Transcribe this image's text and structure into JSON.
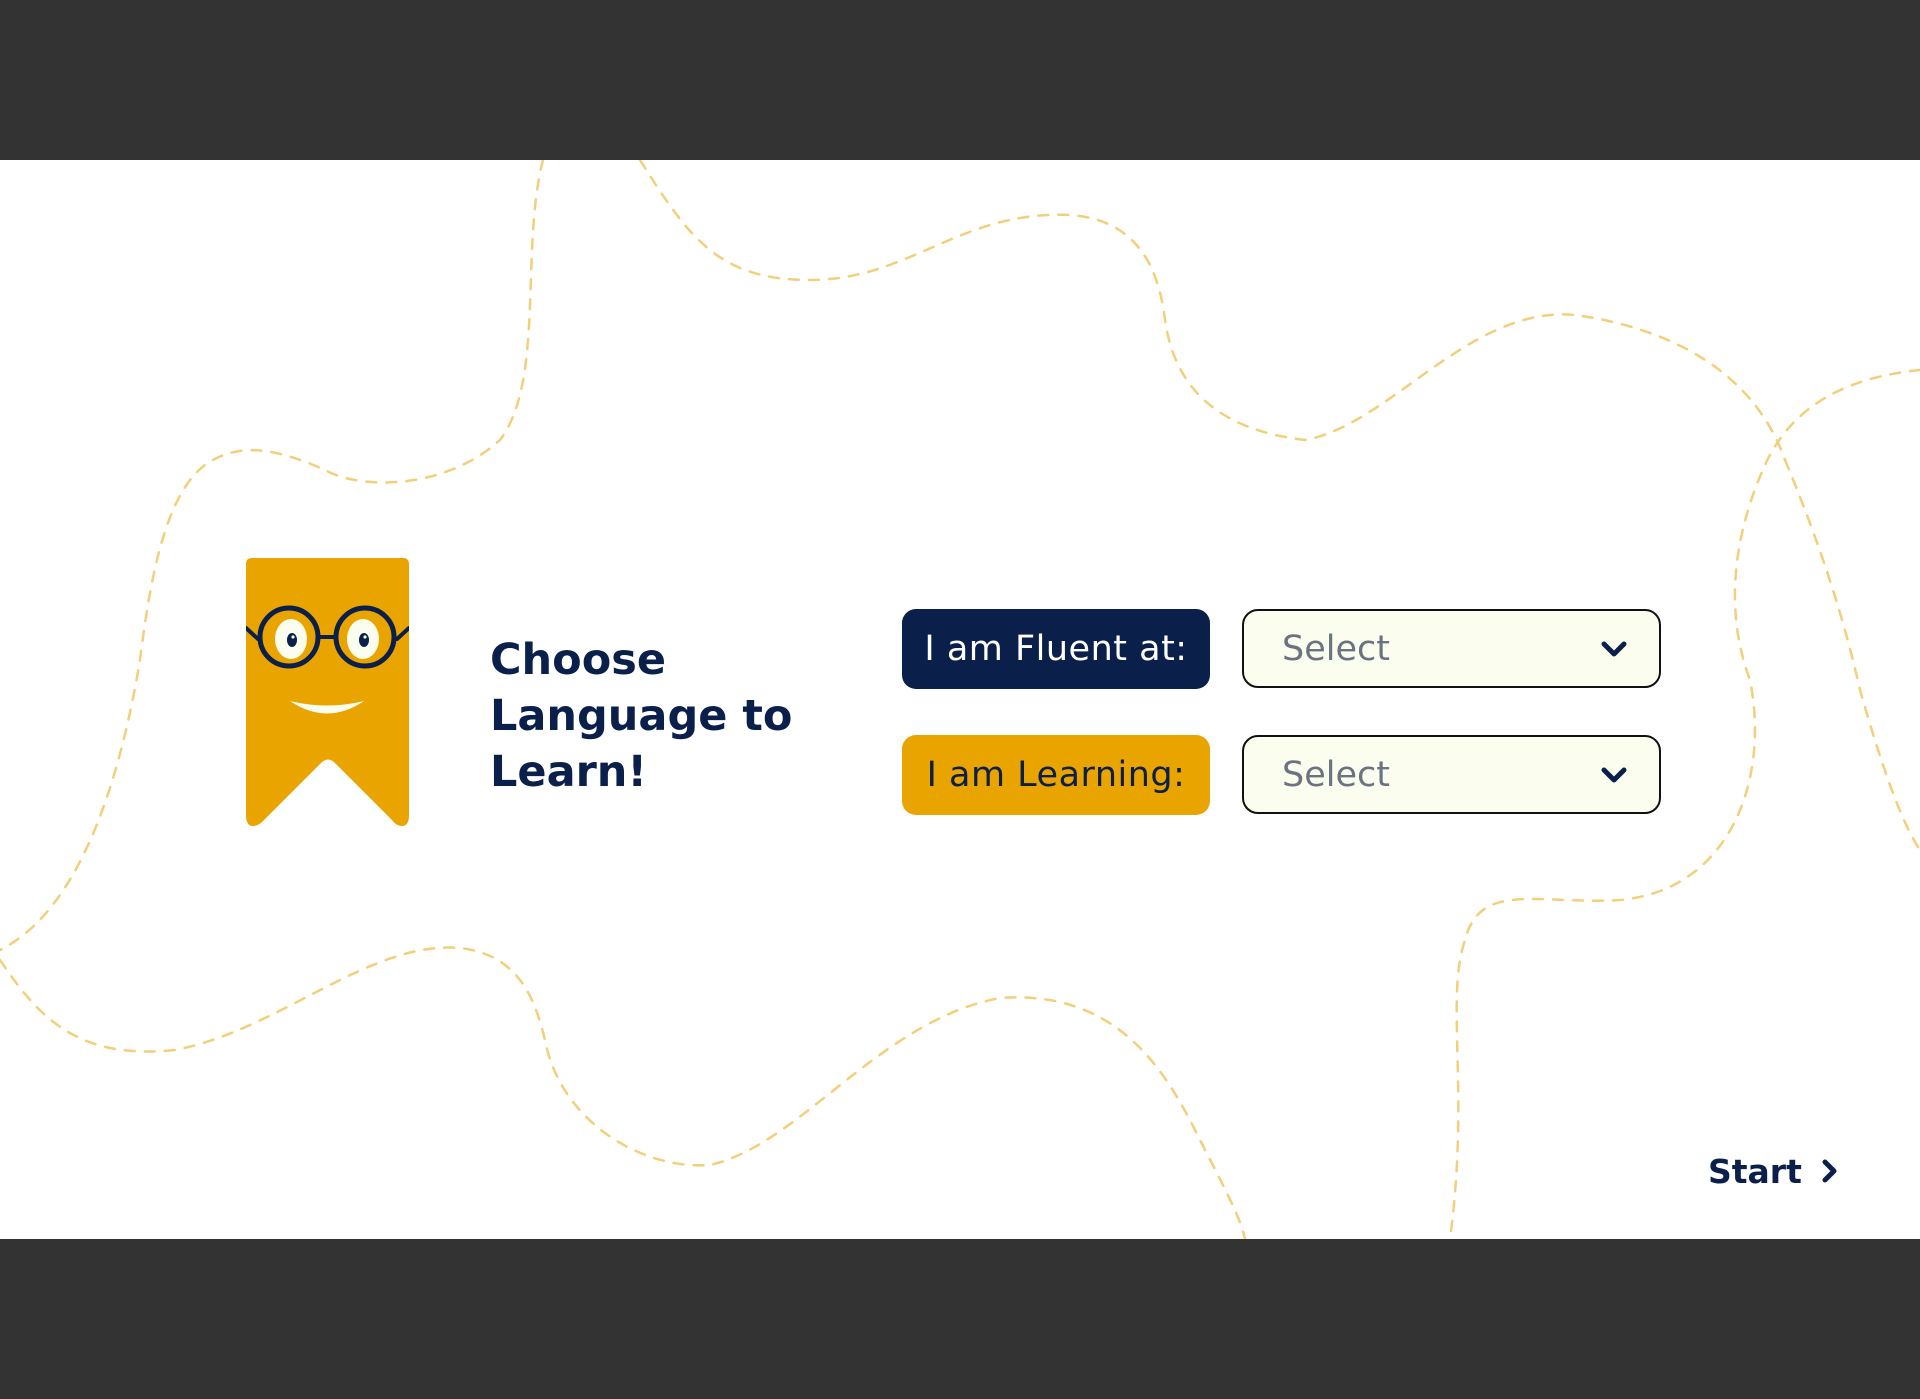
{
  "headline": "Choose Language to Learn!",
  "fluent": {
    "label": "I am Fluent at:",
    "select_value": "Select"
  },
  "learning": {
    "label": "I am Learning:",
    "select_value": "Select"
  },
  "start": {
    "label": "Start"
  },
  "icons": {
    "mascot": "bookmark-mascot-with-glasses",
    "dropdown": "chevron-down-icon",
    "next": "chevron-right-icon"
  },
  "colors": {
    "navy": "#0B1F4B",
    "amber": "#EAA400",
    "select_background": "#FBFEEE",
    "dashed_line": "#F2CF7A",
    "letterbox": "#333333"
  }
}
